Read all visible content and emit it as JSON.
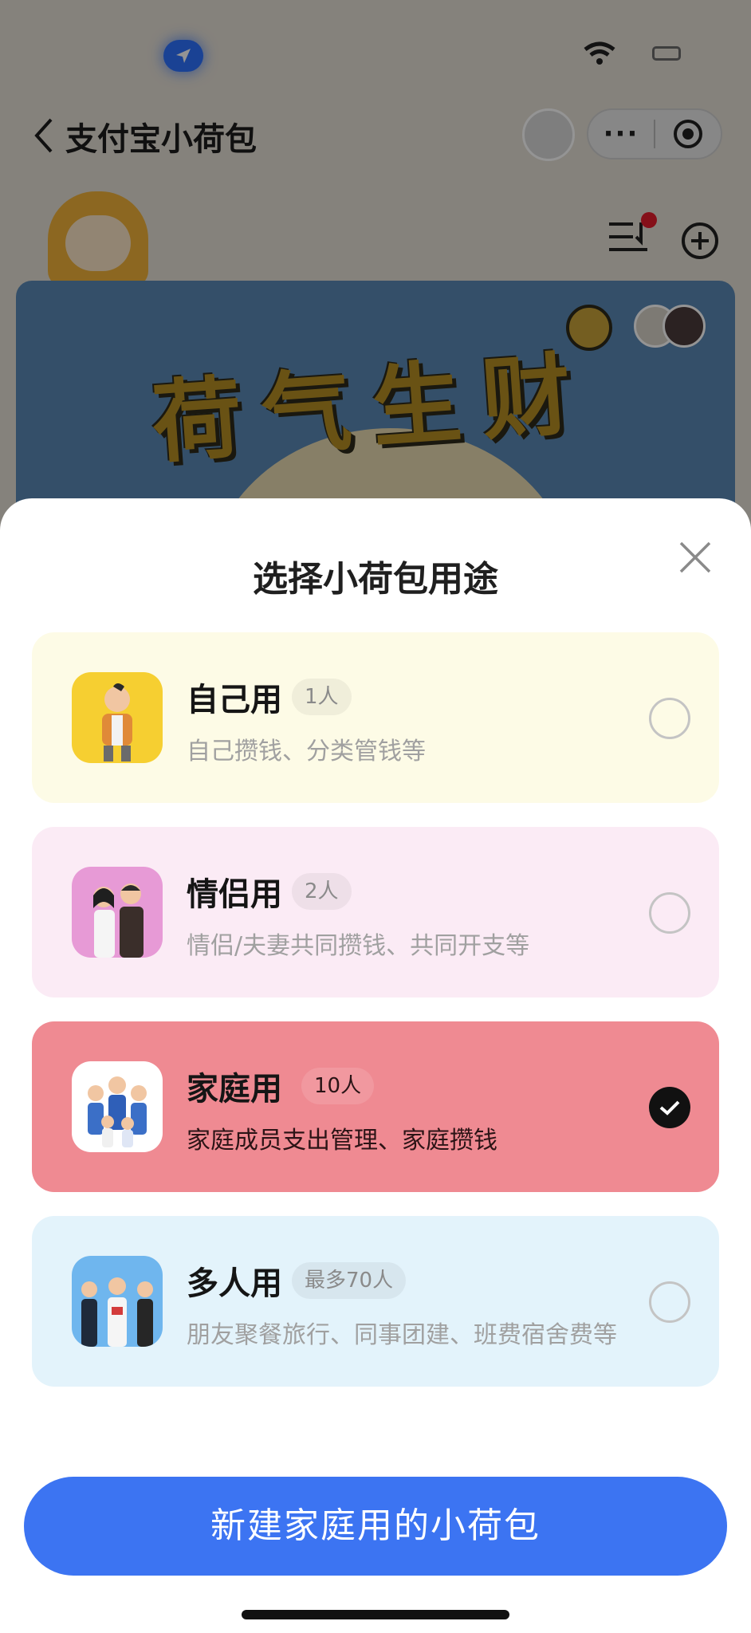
{
  "nav": {
    "title": "支付宝小荷包",
    "more_label": "···"
  },
  "banner": {
    "text": "荷气生财"
  },
  "sheet": {
    "title": "选择小荷包用途",
    "options": [
      {
        "title": "自己用",
        "badge": "1人",
        "desc": "自己攒钱、分类管钱等",
        "selected": false
      },
      {
        "title": "情侣用",
        "badge": "2人",
        "desc": "情侣/夫妻共同攒钱、共同开支等",
        "selected": false
      },
      {
        "title": "家庭用",
        "badge": "10人",
        "desc": "家庭成员支出管理、家庭攒钱",
        "selected": true
      },
      {
        "title": "多人用",
        "badge": "最多70人",
        "desc": "朋友聚餐旅行、同事团建、班费宿舍费等",
        "selected": false
      }
    ],
    "create_button": "新建家庭用的小荷包"
  },
  "colors": {
    "accent": "#3c74f2",
    "self_bg": "#fdfbe6",
    "couple_bg": "#fbebf5",
    "family_bg": "#ef8a92",
    "multi_bg": "#e3f3fb"
  },
  "icons": [
    "location-arrow-icon",
    "wifi-icon",
    "battery-icon",
    "back-chevron-icon",
    "more-dots-icon",
    "target-icon",
    "list-sort-icon",
    "add-circle-icon",
    "close-icon",
    "check-icon"
  ]
}
